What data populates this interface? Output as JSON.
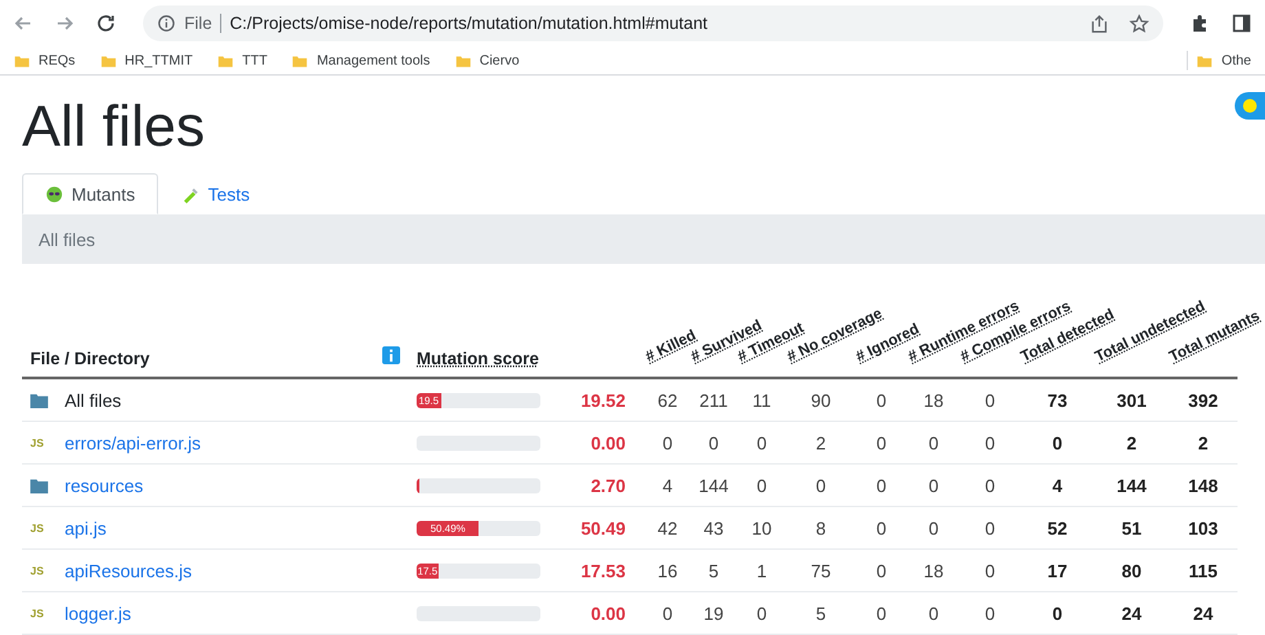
{
  "browser": {
    "scheme": "File",
    "address": "C:/Projects/omise-node/reports/mutation/mutation.html#mutant",
    "bookmarks": [
      "REQs",
      "HR_TTMIT",
      "TTT",
      "Management tools",
      "Ciervo"
    ],
    "other_bookmarks": "Othe"
  },
  "page": {
    "title": "All files",
    "dark_mode": false,
    "tabs": [
      {
        "label": "Mutants",
        "kind": "mutants",
        "selected": true
      },
      {
        "label": "Tests",
        "kind": "tests",
        "selected": false
      }
    ],
    "breadcrumb": "All files",
    "table": {
      "columns": [
        "File / Directory",
        "Mutation score",
        "# Killed",
        "# Survived",
        "# Timeout",
        "# No coverage",
        "# Ignored",
        "# Runtime errors",
        "# Compile errors",
        "Total detected",
        "Total undetected",
        "Total mutants"
      ],
      "rows": [
        {
          "name": "All files",
          "kind": "folder",
          "link": false,
          "level": 0.1952,
          "bar_label": "19.5",
          "score": "19.52",
          "counts": [
            "62",
            "211",
            "11",
            "90",
            "0",
            "18",
            "0"
          ],
          "totals": [
            "73",
            "301",
            "392"
          ]
        },
        {
          "name": "errors/api-error.js",
          "kind": "file",
          "badge": "JS",
          "link": true,
          "score": "0.00",
          "counts": [
            "0",
            "0",
            "0",
            "2",
            "0",
            "0",
            "0"
          ],
          "totals": [
            "0",
            "2",
            "2"
          ]
        },
        {
          "name": "resources",
          "kind": "folder",
          "link": true,
          "level": 0.027,
          "score": "2.70",
          "counts": [
            "4",
            "144",
            "0",
            "0",
            "0",
            "0",
            "0"
          ],
          "totals": [
            "4",
            "144",
            "148"
          ]
        },
        {
          "name": "api.js",
          "kind": "file",
          "badge": "JS",
          "link": true,
          "level": 0.5049,
          "bar_label": "50.49%",
          "score": "50.49",
          "counts": [
            "42",
            "43",
            "10",
            "8",
            "0",
            "0",
            "0"
          ],
          "totals": [
            "52",
            "51",
            "103"
          ]
        },
        {
          "name": "apiResources.js",
          "kind": "file",
          "badge": "JS",
          "link": true,
          "level": 0.1753,
          "bar_label": "17.5",
          "score": "17.53",
          "counts": [
            "16",
            "5",
            "1",
            "75",
            "0",
            "18",
            "0"
          ],
          "totals": [
            "17",
            "80",
            "115"
          ]
        },
        {
          "name": "logger.js",
          "kind": "file",
          "badge": "JS",
          "link": true,
          "score": "0.00",
          "counts": [
            "0",
            "19",
            "0",
            "5",
            "0",
            "0",
            "0"
          ],
          "totals": [
            "0",
            "24",
            "24"
          ]
        }
      ]
    }
  }
}
